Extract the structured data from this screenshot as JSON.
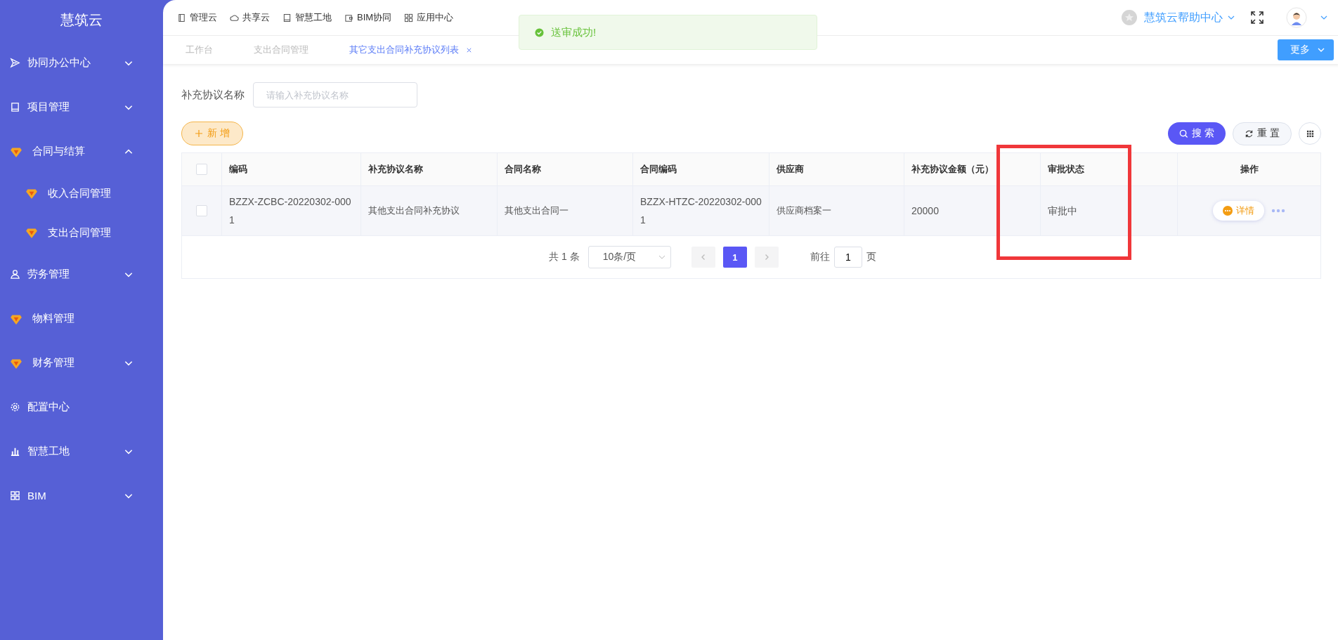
{
  "app_title": "慧筑云",
  "sidebar": {
    "items": [
      {
        "label": "协同办公中心",
        "expandable": true,
        "expanded": false
      },
      {
        "label": "项目管理",
        "expandable": true,
        "expanded": false
      },
      {
        "label": "合同与结算",
        "expandable": true,
        "expanded": true,
        "children": [
          {
            "label": "收入合同管理"
          },
          {
            "label": "支出合同管理"
          }
        ]
      },
      {
        "label": "劳务管理",
        "expandable": true,
        "expanded": false
      },
      {
        "label": "物料管理",
        "expandable": false
      },
      {
        "label": "财务管理",
        "expandable": true,
        "expanded": false
      },
      {
        "label": "配置中心",
        "expandable": false
      },
      {
        "label": "智慧工地",
        "expandable": true,
        "expanded": false
      },
      {
        "label": "BIM",
        "expandable": true,
        "expanded": false
      }
    ]
  },
  "top_nav": [
    "管理云",
    "共享云",
    "智慧工地",
    "BIM协同",
    "应用中心"
  ],
  "help_center": "慧筑云帮助中心",
  "toast": {
    "kind": "success",
    "message": "送审成功!"
  },
  "tabs": [
    {
      "label": "工作台",
      "selected": false,
      "closable": false
    },
    {
      "label": "支出合同管理",
      "selected": false,
      "closable": false
    },
    {
      "label": "其它支出合同补充协议列表",
      "selected": true,
      "closable": true
    }
  ],
  "more_button": "更多",
  "filter": {
    "label": "补充协议名称",
    "placeholder": "请输入补充协议名称"
  },
  "add_button": "新 增",
  "search_button": "搜 索",
  "reset_button": "重 置",
  "table": {
    "columns": [
      "编码",
      "补充协议名称",
      "合同名称",
      "合同编码",
      "供应商",
      "补充协议金额（元）",
      "审批状态",
      "操作"
    ],
    "rows": [
      {
        "checked": false,
        "cells": [
          "BZZX-ZCBC-20220302-0001",
          "其他支出合同补充协议",
          "其他支出合同一",
          "BZZX-HTZC-20220302-0001",
          "供应商档案一",
          "20000",
          "审批中"
        ],
        "action": "详情"
      }
    ],
    "header_checked": false
  },
  "pagination": {
    "total": "共 1 条",
    "page_size": "10条/页",
    "pages": [
      {
        "label": "1",
        "selected": true
      }
    ],
    "goto_label": "前往",
    "goto_value": "1",
    "goto_suffix": "页"
  }
}
